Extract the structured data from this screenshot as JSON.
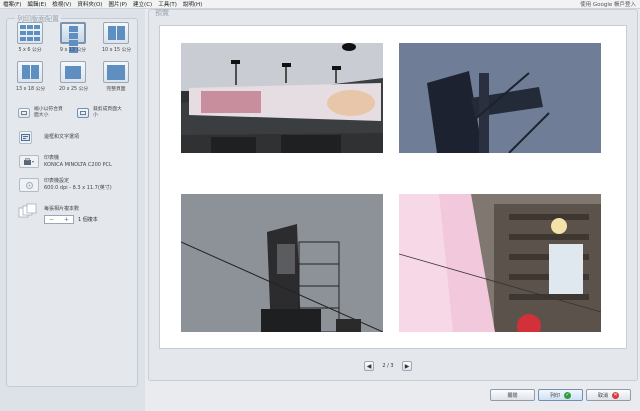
{
  "menubar": {
    "items": [
      "檔案(F)",
      "編輯(E)",
      "檢視(V)",
      "資料夾(O)",
      "圖片(P)",
      "建立(C)",
      "工具(T)",
      "說明(H)"
    ],
    "account": "使用 Google 帳戶登入"
  },
  "layout_section": {
    "title": "列印版面配置",
    "options": [
      {
        "label": "5 x 6 公分",
        "cols": 3,
        "rows": 3,
        "selected": false
      },
      {
        "label": "9 x 13 公分",
        "cols": 2,
        "rows": 2,
        "selected": true
      },
      {
        "label": "10 x 15 公分",
        "cols": 2,
        "rows": 1,
        "selected": false
      },
      {
        "label": "13 x 18 公分",
        "cols": 2,
        "rows": 1,
        "selected": false
      },
      {
        "label": "20 x 25 公分",
        "cols": 1,
        "rows": 1,
        "selected": false
      },
      {
        "label": "完整頁面",
        "cols": 1,
        "rows": 1,
        "selected": false
      }
    ]
  },
  "fit": {
    "shrink_label": "縮小以符合頁面大小",
    "crop_label": "裁剪成頁面大小"
  },
  "options_section": {
    "border_text_label": "邊框和文字選項",
    "printer_label": "印表機",
    "printer_value": "KONICA MINOLTA C200 PCL",
    "printer_settings_label": "印表機設定",
    "printer_settings_value": "600.0 dpi - 8.3 x 11.7(英寸)",
    "copies_label": "每張相片複本數",
    "copies_minus": "－",
    "copies_plus": "＋",
    "copies_value": "1 個複本"
  },
  "preview": {
    "title": "預覽",
    "page_indicator": "2 / 3",
    "prev": "◀",
    "next": "▶"
  },
  "footer": {
    "close_label": "關閉",
    "print_label": "列印",
    "cancel_label": "取消"
  },
  "colors": {
    "accent": "#5f8fc0",
    "print_icon": "#2f9e3a",
    "cancel_icon": "#d93a3a"
  },
  "icons": {
    "border_text": "text-frame-icon",
    "printer": "printer-icon",
    "printer_settings": "settings-icon",
    "copies": "copies-icon"
  }
}
